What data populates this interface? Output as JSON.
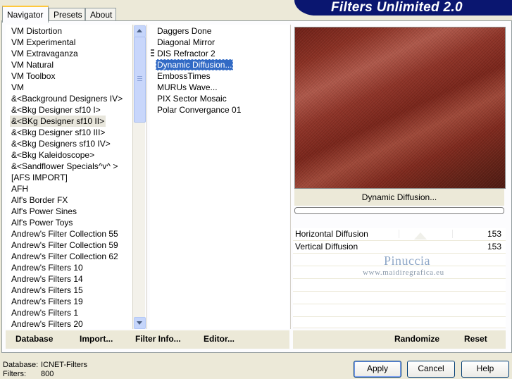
{
  "tabs": [
    {
      "label": "Navigator",
      "active": true
    },
    {
      "label": "Presets",
      "active": false
    },
    {
      "label": "About",
      "active": false
    }
  ],
  "header": {
    "title": "Filters Unlimited 2.0"
  },
  "categories": [
    "VM Distortion",
    "VM Experimental",
    "VM Extravaganza",
    "VM Natural",
    "VM Toolbox",
    "VM",
    "&<Background Designers IV>",
    "&<Bkg Designer sf10 I>",
    "&<BKg Designer sf10 II>",
    "&<Bkg Designer sf10 III>",
    "&<Bkg Designers sf10 IV>",
    "&<Bkg Kaleidoscope>",
    "&<Sandflower Specials^v^ >",
    "[AFS IMPORT]",
    "AFH",
    "Alf's Border FX",
    "Alf's Power Sines",
    "Alf's Power Toys",
    "Andrew's Filter Collection 55",
    "Andrew's Filter Collection 59",
    "Andrew's Filter Collection 62",
    "Andrew's Filters 10",
    "Andrew's Filters 14",
    "Andrew's Filters 15",
    "Andrew's Filters 19",
    "Andrew's Filters 1",
    "Andrew's Filters 20"
  ],
  "selected_category": "&<BKg Designer sf10 II>",
  "filters": [
    "Daggers Done",
    "Diagonal Mirror",
    "DIS Refractor 2",
    "Dynamic Diffusion...",
    "EmbossTimes",
    "MURUs Wave...",
    "PIX Sector Mosaic",
    "Polar Convergance 01"
  ],
  "selected_filter": "Dynamic Diffusion...",
  "preview": {
    "effect_name": "Dynamic Diffusion...",
    "colors": {
      "base": "#7a2419",
      "highlight": "#b0584a"
    }
  },
  "params": [
    {
      "name": "Horizontal Diffusion",
      "value": "153"
    },
    {
      "name": "Vertical Diffusion",
      "value": "153"
    }
  ],
  "watermark": {
    "name": "Pinuccia",
    "url": "www.maidiregrafica.eu"
  },
  "left_buttons": {
    "database": "Database",
    "import": "Import...",
    "filter_info": "Filter Info...",
    "editor": "Editor..."
  },
  "right_buttons": {
    "randomize": "Randomize",
    "reset": "Reset"
  },
  "status": {
    "database_label": "Database:",
    "database_value": "ICNET-Filters",
    "filters_label": "Filters:",
    "filters_value": "800"
  },
  "dialog_buttons": {
    "apply": "Apply",
    "cancel": "Cancel",
    "help": "Help"
  },
  "colors": {
    "banner": "#0a1670",
    "selection": "#316ac5",
    "tab_highlight": "#ffc83c"
  }
}
